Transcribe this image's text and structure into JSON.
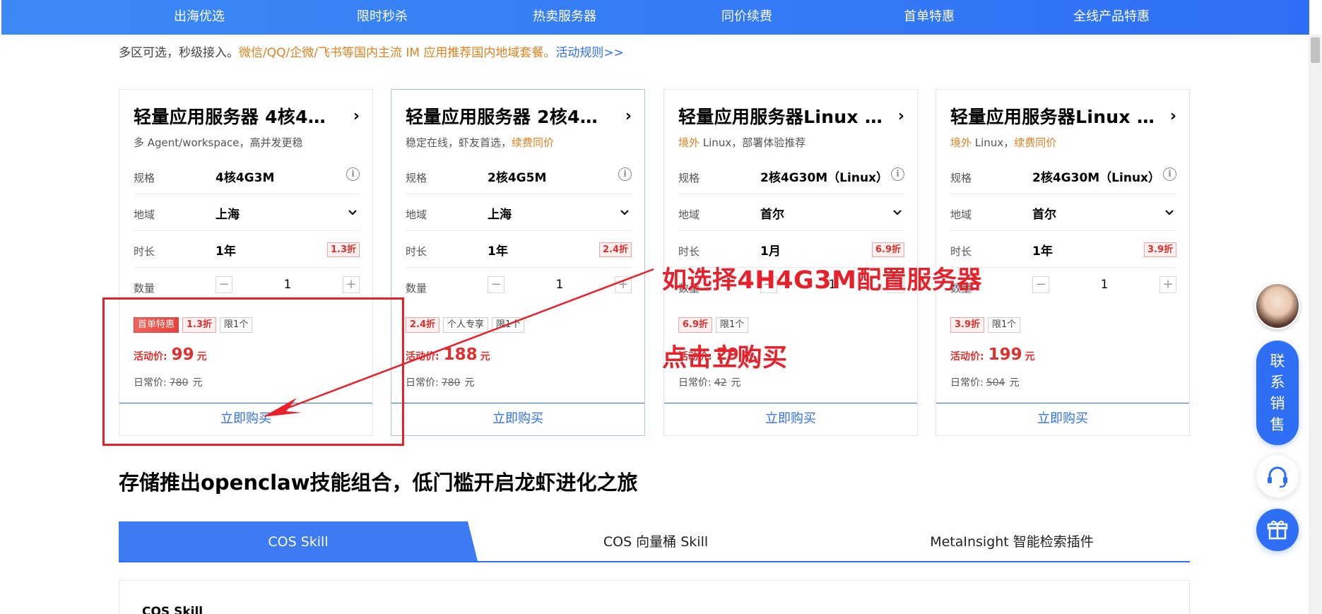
{
  "topnav": {
    "items": [
      "出海优选",
      "限时秒杀",
      "热卖服务器",
      "同价续费",
      "首单特惠",
      "全线产品特惠"
    ]
  },
  "notice": {
    "text1": "多区可选，秒级接入。",
    "highlight": "微信/QQ/企微/飞书等国内主流 IM 应用推荐国内地域套餐。",
    "rule_link": "活动规则>>"
  },
  "labels": {
    "spec": "规格",
    "region": "地域",
    "duration": "时长",
    "quantity": "数量",
    "activity_price": "活动价:",
    "regular_price": "日常价:",
    "yuan": "元",
    "buy": "立即购买",
    "minus": "−",
    "plus": "+",
    "info": "i",
    "chevron": "›"
  },
  "cards": [
    {
      "title": "轻量应用服务器 4核4G3M",
      "sub_prefix": "",
      "sub": "多 Agent/workspace，高并发更稳",
      "sub_suffix": "",
      "spec": "4核4G3M",
      "region": "上海",
      "duration": "1年",
      "duration_discount": "1.3折",
      "quantity": "1",
      "tags": [
        {
          "text": "首单特惠",
          "style": "first"
        },
        {
          "text": "1.3折",
          "style": "red"
        },
        {
          "text": "限1个",
          "style": "gray"
        }
      ],
      "price": "99",
      "orig_price": "780"
    },
    {
      "title": "轻量应用服务器 2核4G5M",
      "sub_prefix": "",
      "sub": "稳定在线，虾友首选，",
      "sub_suffix": "续费同价",
      "spec": "2核4G5M",
      "region": "上海",
      "duration": "1年",
      "duration_discount": "2.4折",
      "quantity": "1",
      "tags": [
        {
          "text": "2.4折",
          "style": "red"
        },
        {
          "text": "个人专享",
          "style": "gray"
        },
        {
          "text": "限1个",
          "style": "gray"
        }
      ],
      "price": "188",
      "orig_price": "780"
    },
    {
      "title": "轻量应用服务器Linux 2核4G30M",
      "sub_prefix": "境外",
      "sub": " Linux，部署体验推荐",
      "sub_suffix": "",
      "spec": "2核4G30M（Linux）",
      "region": "首尔",
      "duration": "1月",
      "duration_discount": "6.9折",
      "quantity": "1",
      "tags": [
        {
          "text": "6.9折",
          "style": "red"
        },
        {
          "text": "限1个",
          "style": "gray"
        }
      ],
      "price": "29",
      "orig_price": "42"
    },
    {
      "title": "轻量应用服务器Linux 2核4G30M",
      "sub_prefix": "境外",
      "sub": " Linux，",
      "sub_suffix": "续费同价",
      "spec": "2核4G30M（Linux）",
      "region": "首尔",
      "duration": "1年",
      "duration_discount": "3.9折",
      "quantity": "1",
      "tags": [
        {
          "text": "3.9折",
          "style": "red"
        },
        {
          "text": "限1个",
          "style": "gray"
        }
      ],
      "price": "199",
      "orig_price": "504"
    }
  ],
  "section": {
    "title": "存储推出openclaw技能组合，低门槛开启龙虾进化之旅",
    "tabs": [
      "COS Skill",
      "COS 向量桶 Skill",
      "MetaInsight 智能检索插件"
    ],
    "panel_title": "COS Skill"
  },
  "annotations": {
    "line1": "如选择4H4G3M配置服务器",
    "line2": "点击立购买",
    "color": "#e8202a"
  },
  "floating": {
    "contact_chars": [
      "联",
      "系",
      "销",
      "售"
    ]
  },
  "colors": {
    "brand": "#2f6ff5",
    "price_red": "#e02f2f",
    "orange": "#e0821f"
  }
}
